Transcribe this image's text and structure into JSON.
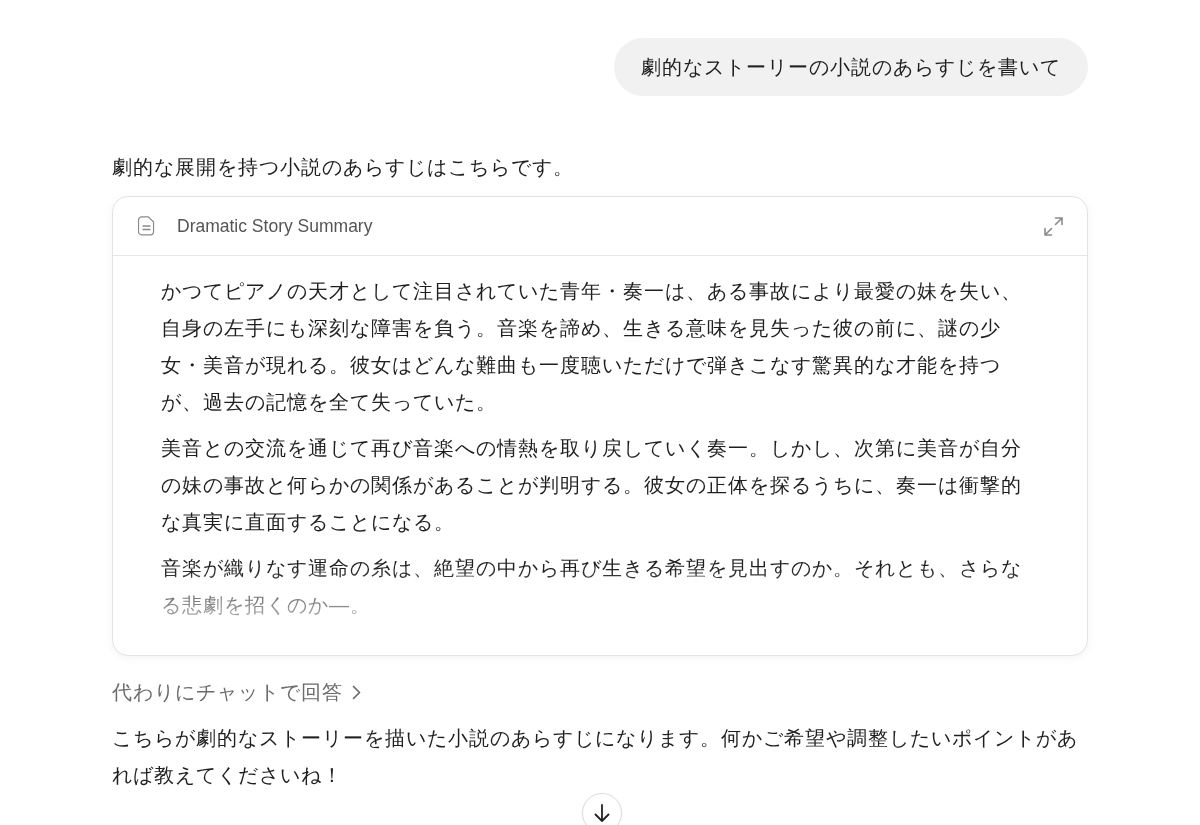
{
  "conversation": [
    {
      "kind": "user",
      "text": "劇的なストーリーの小説のあらすじを書いて"
    },
    {
      "kind": "assistant",
      "intro": "劇的な展開を持つ小説のあらすじはこちらです。",
      "artifact": {
        "title": "Dramatic Story Summary",
        "paragraphs": [
          "かつてピアノの天才として注目されていた青年・奏一は、ある事故により最愛の妹を失い、自身の左手にも深刻な障害を負う。音楽を諦め、生きる意味を見失った彼の前に、謎の少女・美音が現れる。彼女はどんな難曲も一度聴いただけで弾きこなす驚異的な才能を持つが、過去の記憶を全て失っていた。",
          "美音との交流を通じて再び音楽への情熱を取り戻していく奏一。しかし、次第に美音が自分の妹の事故と何らかの関係があることが判明する。彼女の正体を探るうちに、奏一は衝撃的な真実に直面することになる。",
          "音楽が織りなす運命の糸は、絶望の中から再び生きる希望を見出すのか。それとも、さらなる悲劇を招くのか―。"
        ]
      },
      "chat_link": "代わりにチャットで回答",
      "outro": "こちらが劇的なストーリーを描いた小説のあらすじになります。何かご希望や調整したいポイントがあれば教えてくださいね！"
    }
  ]
}
